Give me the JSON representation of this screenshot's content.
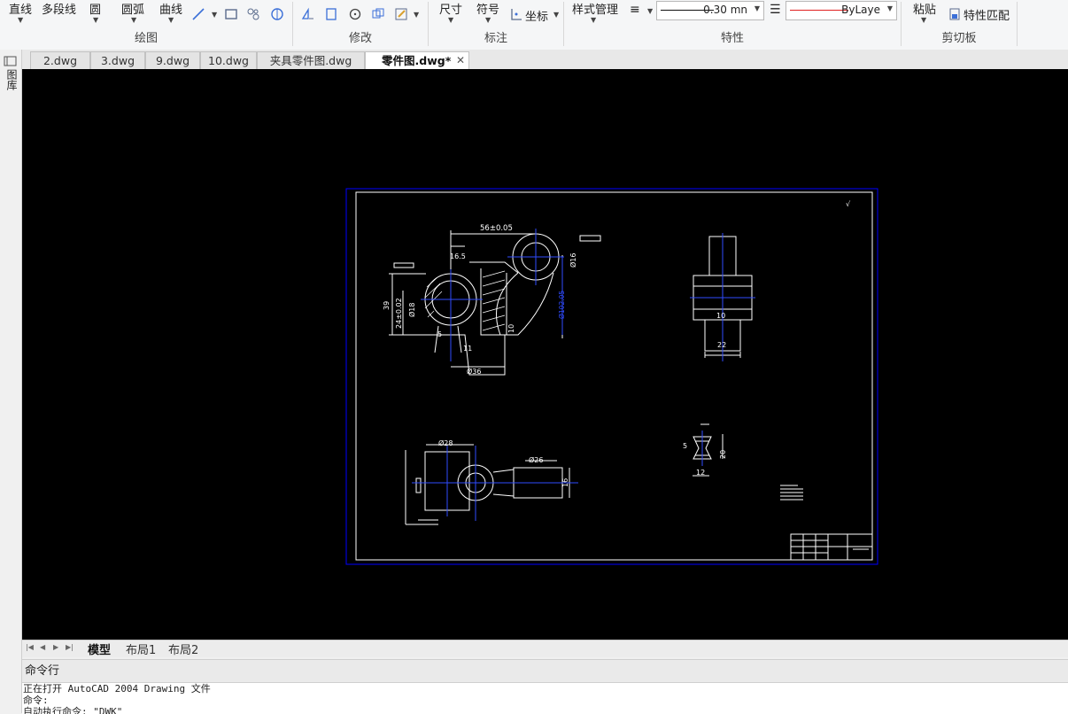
{
  "ribbon": {
    "draw": {
      "line": "直线",
      "polyline": "多段线",
      "circle": "圆",
      "arc": "圆弧",
      "curve": "曲线",
      "label": "绘图"
    },
    "modify": {
      "label": "修改"
    },
    "annotate": {
      "dimension": "尺寸",
      "symbol": "符号",
      "coordinate": "坐标",
      "label": "标注"
    },
    "properties": {
      "style_manager": "样式管理",
      "lineweight": "0.30 mn",
      "color": "ByLaye",
      "color_hex": "#e02020",
      "label": "特性"
    },
    "clipboard": {
      "paste": "粘贴",
      "match_properties": "特性匹配",
      "label": "剪切板"
    }
  },
  "doc_tabs": [
    {
      "label": "2.dwg"
    },
    {
      "label": "3.dwg"
    },
    {
      "label": "9.dwg"
    },
    {
      "label": "10.dwg"
    },
    {
      "label": "夹具零件图.dwg"
    },
    {
      "label": "零件图.dwg*"
    }
  ],
  "side_panel": {
    "label": "图库"
  },
  "drawing": {
    "dims": {
      "d56": "56±0.05",
      "d16_5": "16.5",
      "d16": "Ø16",
      "d39": "39",
      "d24": "24±0.02",
      "d18": "Ø18",
      "d36": "Ø36",
      "d10": "10",
      "d5": "5",
      "d11": "11",
      "d22": "22",
      "d10b": "10",
      "d28": "Ø28",
      "d26": "Ø26",
      "d16b": "16",
      "d5b": "5",
      "d20": "20",
      "d12": "12",
      "d102": "Ø102.05"
    },
    "colors": {
      "background": "#000000",
      "frame": "#0000ff",
      "lines": "#ffffff",
      "center": "#2f4bff"
    }
  },
  "layout_tabs": [
    {
      "label": "模型"
    },
    {
      "label": "布局1"
    },
    {
      "label": "布局2"
    }
  ],
  "command": {
    "title": "命令行",
    "log": [
      "正在打开 AutoCAD 2004 Drawing 文件",
      "命令:",
      "自动执行命令: \"DWK\""
    ]
  }
}
